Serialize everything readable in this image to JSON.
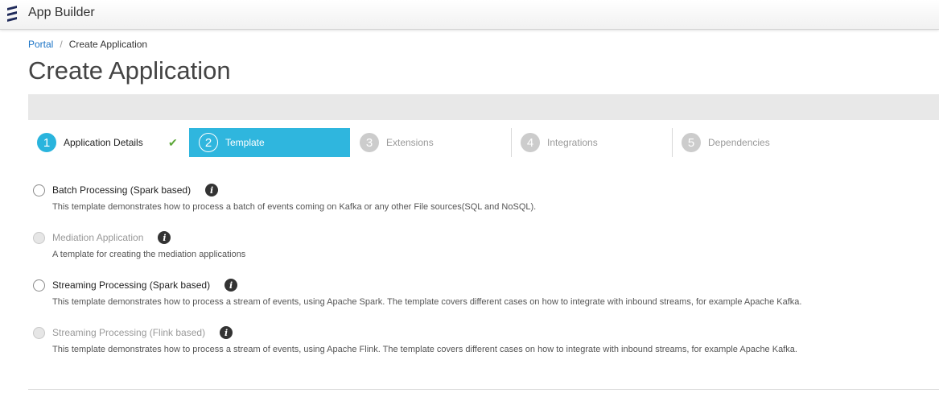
{
  "app": {
    "title": "App Builder"
  },
  "breadcrumb": {
    "portal": "Portal",
    "separator": "/",
    "current": "Create Application"
  },
  "page": {
    "title": "Create Application"
  },
  "steps": [
    {
      "num": "1",
      "label": "Application Details",
      "state": "done"
    },
    {
      "num": "2",
      "label": "Template",
      "state": "active"
    },
    {
      "num": "3",
      "label": "Extensions",
      "state": "pending"
    },
    {
      "num": "4",
      "label": "Integrations",
      "state": "pending"
    },
    {
      "num": "5",
      "label": "Dependencies",
      "state": "pending"
    }
  ],
  "templates": [
    {
      "label": "Batch Processing (Spark based)",
      "description": "This template demonstrates how to process a batch of events coming on Kafka or any other File sources(SQL and NoSQL).",
      "enabled": true
    },
    {
      "label": "Mediation Application",
      "description": "A template for creating the mediation applications",
      "enabled": false
    },
    {
      "label": "Streaming Processing (Spark based)",
      "description": "This template demonstrates how to process a stream of events, using Apache Spark. The template covers different cases on how to integrate with inbound streams, for example Apache Kafka.",
      "enabled": true
    },
    {
      "label": "Streaming Processing (Flink based)",
      "description": "This template demonstrates how to process a stream of events, using Apache Flink. The template covers different cases on how to integrate with inbound streams, for example Apache Kafka.",
      "enabled": false
    }
  ],
  "colors": {
    "accent": "#2fb6de",
    "check": "#5ea83a",
    "link": "#1a73c6"
  },
  "icons": {
    "logo": "brand-logo-icon",
    "check": "checkmark-icon",
    "info": "info-icon"
  }
}
